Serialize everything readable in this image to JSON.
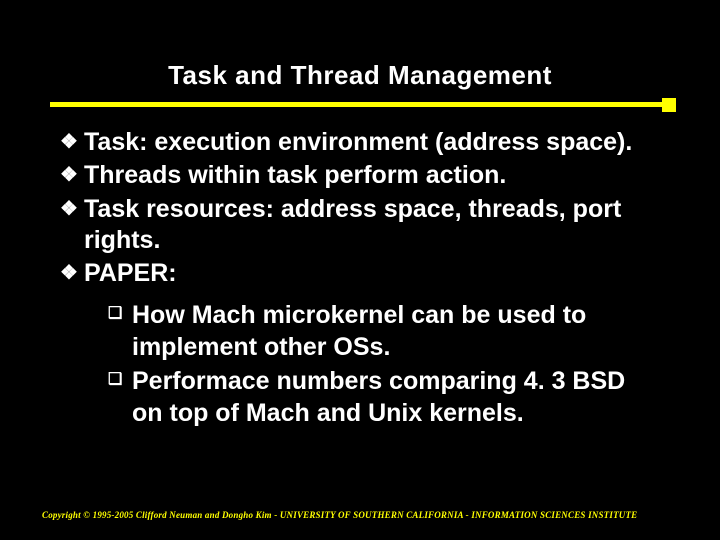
{
  "title": "Task and Thread Management",
  "bullets": [
    "Task: execution environment (address space).",
    "Threads within task perform action.",
    "Task resources: address space, threads, port rights.",
    "PAPER:"
  ],
  "sub_bullets": [
    "How Mach microkernel can be used to implement other OSs.",
    "Performace numbers comparing 4. 3 BSD on top of Mach and Unix kernels."
  ],
  "markers": {
    "l1": "❖",
    "l2": "❑"
  },
  "footer": "Copyright © 1995-2005 Clifford Neuman and Dongho Kim - UNIVERSITY OF SOUTHERN CALIFORNIA - INFORMATION SCIENCES INSTITUTE"
}
